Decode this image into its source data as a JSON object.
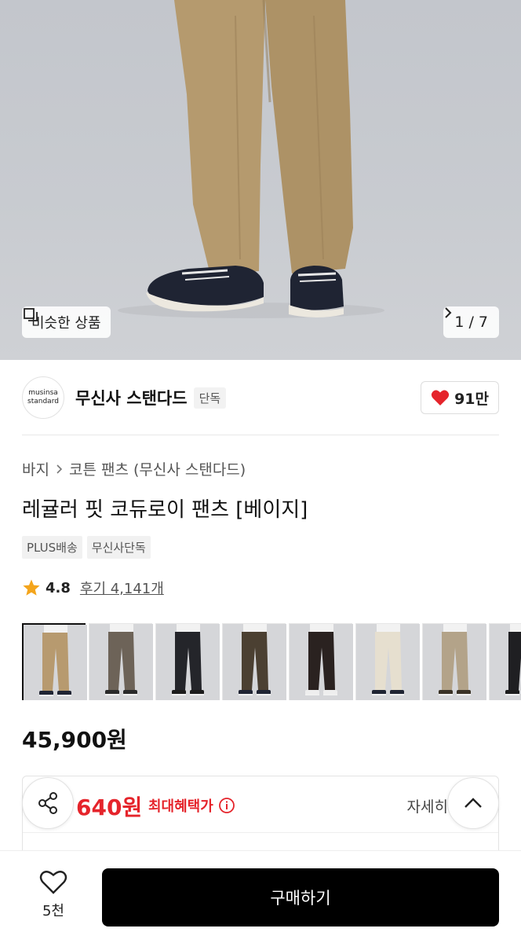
{
  "hero": {
    "similar_label": "비슷한 상품",
    "counter": "1 / 7"
  },
  "brand": {
    "logo_line1": "musinsa",
    "logo_line2": "standard",
    "name": "무신사 스탠다드",
    "badge": "단독",
    "like_count": "91만"
  },
  "product": {
    "breadcrumb": [
      "바지",
      "코튼 팬츠 (무신사 스탠다드)"
    ],
    "title": "레귤러 핏 코듀로이 팬츠 [베이지]",
    "tags": [
      "PLUS배송",
      "무신사단독"
    ],
    "rating": "4.8",
    "reviews": "후기 4,141개",
    "price": "45,900원"
  },
  "thumbnails": [
    {
      "color": "#b79a6f",
      "shoe": "#1f2433",
      "selected": true
    },
    {
      "color": "#6d6358",
      "shoe": "#2a2a2a",
      "selected": false
    },
    {
      "color": "#24252a",
      "shoe": "#1c1c1c",
      "selected": false
    },
    {
      "color": "#4b4032",
      "shoe": "#1f2433",
      "selected": false
    },
    {
      "color": "#2a2220",
      "shoe": "#eeeeee",
      "selected": false
    },
    {
      "color": "#e6dfcf",
      "shoe": "#1f2433",
      "selected": false
    },
    {
      "color": "#b3a389",
      "shoe": "#3a3226",
      "selected": false
    },
    {
      "color": "#1f1f22",
      "shoe": "#1c1c1c",
      "selected": false
    }
  ],
  "benefit": {
    "price": "640원",
    "label": "최대혜택가",
    "detail": "자세히"
  },
  "bottom": {
    "wish_count": "5천",
    "buy_label": "구매하기"
  },
  "colors": {
    "accent_red": "#e5242b",
    "pants": "#b59a6e",
    "buy_button": "#000000"
  },
  "icons": [
    "copy-icon",
    "chevron-right-icon",
    "heart-filled-icon",
    "star-icon",
    "info-icon",
    "share-icon",
    "chevron-up-icon",
    "heart-outline-icon"
  ]
}
